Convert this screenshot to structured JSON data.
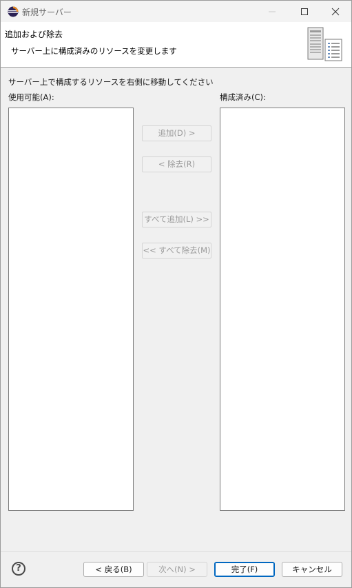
{
  "window": {
    "title": "新規サーバー"
  },
  "banner": {
    "title": "追加および除去",
    "description": "サーバー上に構成済みのリソースを変更します",
    "image_icon": "server-wizard-icon"
  },
  "content": {
    "instruction": "サーバー上で構成するリソースを右側に移動してください",
    "available_label": "使用可能(A):",
    "configured_label": "構成済み(C):",
    "available_items": [],
    "configured_items": [],
    "buttons": {
      "add": "追加(D) >",
      "remove": "< 除去(R)",
      "add_all": "すべて追加(L) >>",
      "remove_all": "<< すべて除去(M)"
    }
  },
  "footer": {
    "back": "< 戻る(B)",
    "next": "次へ(N) >",
    "finish": "完了(F)",
    "cancel": "キャンセル",
    "help_icon": "help-icon"
  },
  "colors": {
    "accent": "#0067c0",
    "disabled_text": "#9a9a9a",
    "dialog_bg": "#f0f0f0"
  }
}
